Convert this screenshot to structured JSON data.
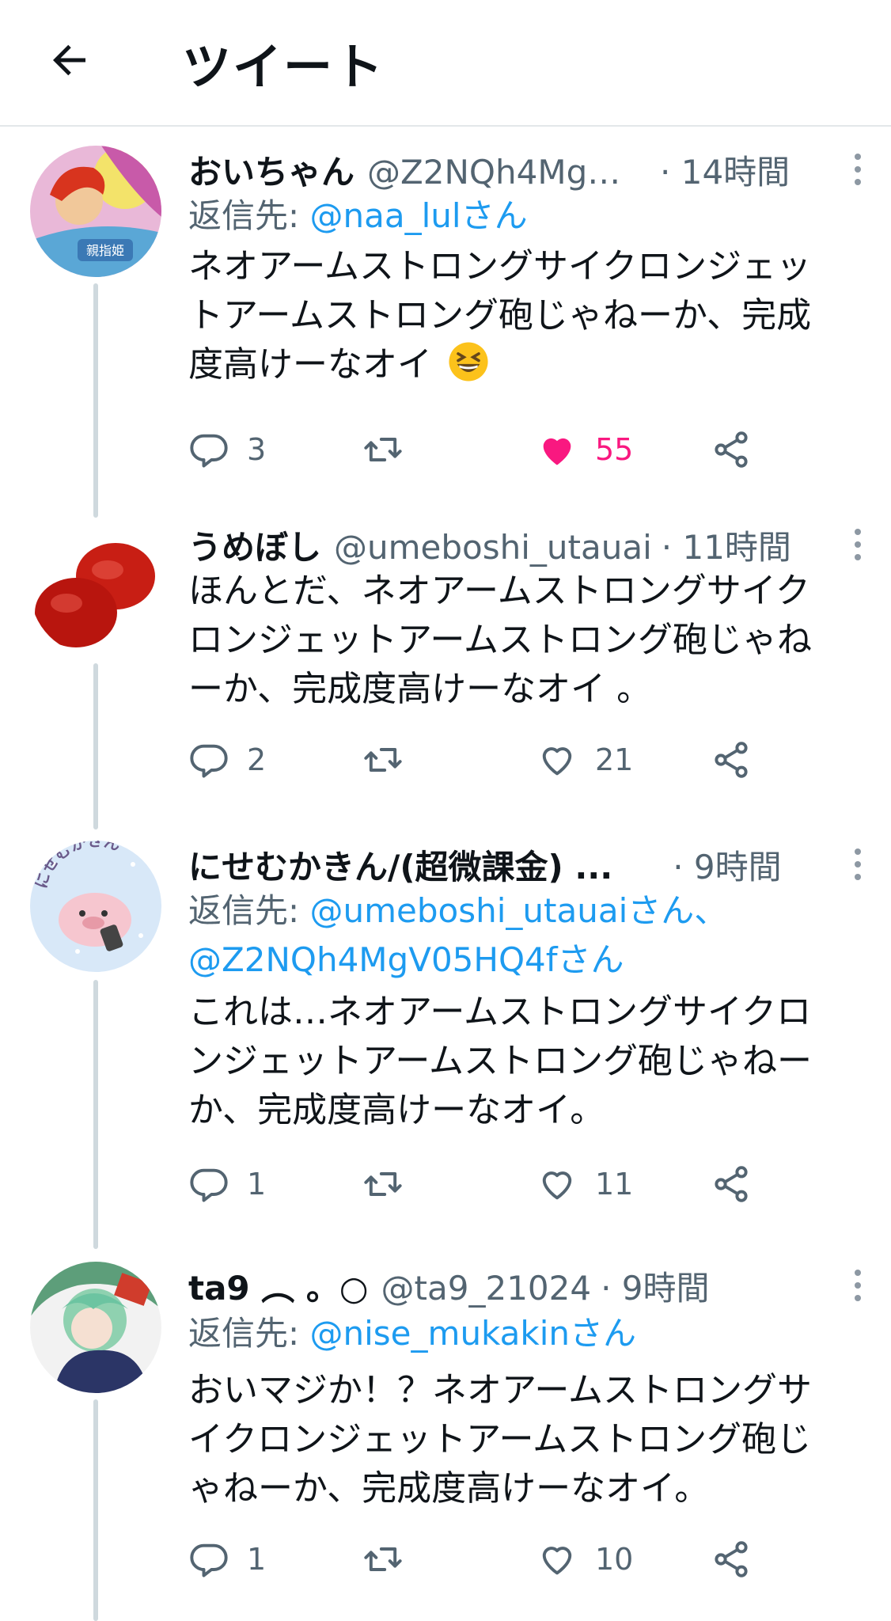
{
  "header": {
    "title": "ツイート"
  },
  "tweets": [
    {
      "name": "おいちゃん",
      "handle": "@Z2NQh4MgV...",
      "time": "· 14時間",
      "reply_prefix": "返信先: ",
      "reply_mentions": "@naa_lulさん",
      "lines": [
        "ネオアームストロングサイクロンジェッ",
        "トアームストロング砲じゃねーか、完成",
        "度高けーなオイ"
      ],
      "emoji": "grinning-squinting-face",
      "replies": "3",
      "retweets": "",
      "likes": "55",
      "liked": true,
      "avatar_text": "親指姫"
    },
    {
      "name": "うめぼし",
      "handle": "@umeboshi_utauai",
      "time": "· 11時間",
      "lines": [
        "ほんとだ、ネオアームストロングサイク",
        "ロンジェットアームストロング砲じゃね",
        "ーか、完成度高けーなオイ 。"
      ],
      "replies": "2",
      "retweets": "",
      "likes": "21",
      "liked": false
    },
    {
      "name": "にせむかきん/(超微課金) ...",
      "handle": "",
      "time": "· 9時間",
      "reply_prefix": "返信先: ",
      "reply_mentions": "@umeboshi_utauaiさん、",
      "reply_mentions2": "@Z2NQh4MgV05HQ4fさん",
      "lines": [
        "これは…ネオアームストロングサイクロ",
        "ンジェットアームストロング砲じゃねー",
        "か、完成度高けーなオイ。"
      ],
      "replies": "1",
      "retweets": "",
      "likes": "11",
      "liked": false,
      "avatar_text": "にせむかきん"
    },
    {
      "name": "ta9 ︵ 。○",
      "handle": "@ta9_21024",
      "time": "· 9時間",
      "reply_prefix": "返信先: ",
      "reply_mentions": "@nise_mukakinさん",
      "lines": [
        "おいマジか！？ネオアームストロングサ",
        "イクロンジェットアームストロング砲じ",
        "ゃねーか、完成度高けーなオイ。"
      ],
      "replies": "1",
      "retweets": "",
      "likes": "10",
      "liked": false
    }
  ],
  "colors": {
    "accent": "#1d9bf0",
    "like": "#f91880",
    "muted": "#536471"
  }
}
